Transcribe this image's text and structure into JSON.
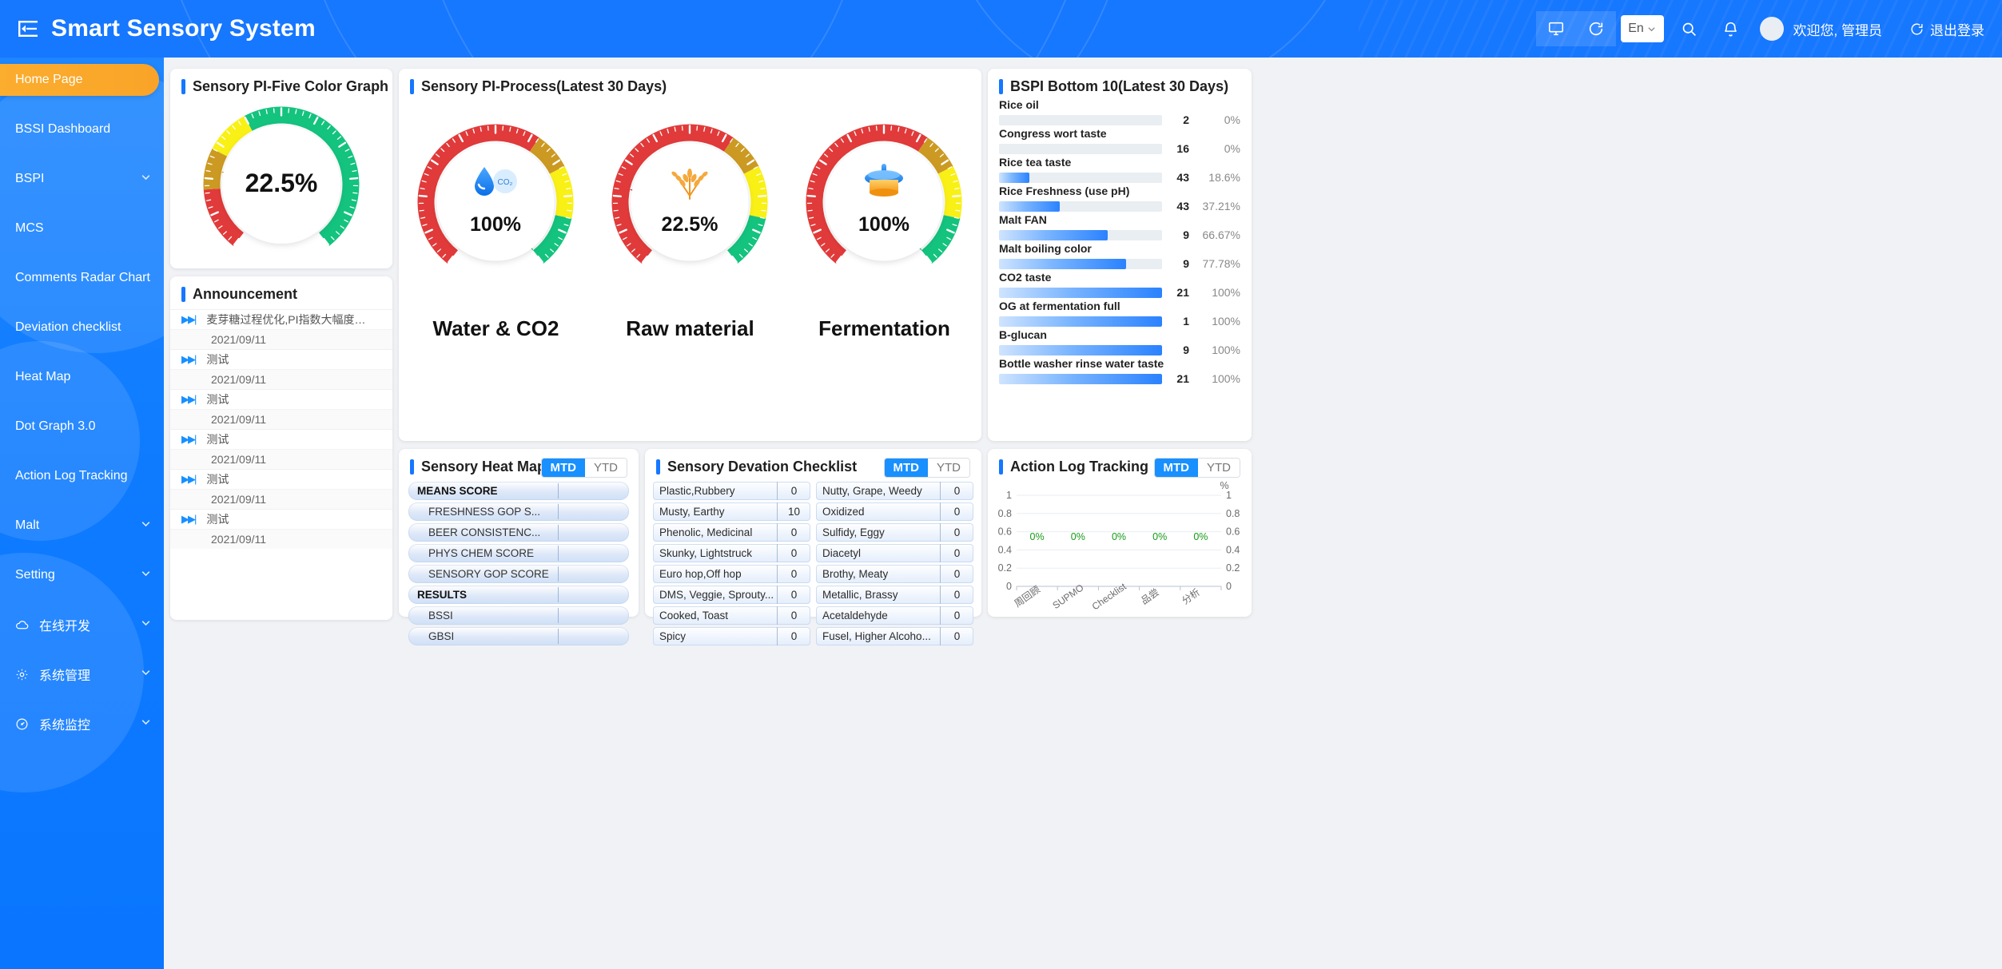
{
  "header": {
    "title": "Smart Sensory System",
    "menu_icon": "hamburger-collapse-icon",
    "monitor_icon": "monitor-icon",
    "refresh_icon": "refresh-icon",
    "language": "En",
    "search_icon": "search-icon",
    "bell_icon": "bell-icon",
    "welcome": "欢迎您, 管理员",
    "logout": "退出登录"
  },
  "sidebar": {
    "items": [
      {
        "label": "Home Page",
        "active": true,
        "caret": false,
        "icon": ""
      },
      {
        "label": "BSSI Dashboard",
        "active": false,
        "caret": false,
        "icon": ""
      },
      {
        "label": "BSPI",
        "active": false,
        "caret": true,
        "icon": ""
      },
      {
        "label": "MCS",
        "active": false,
        "caret": false,
        "icon": ""
      },
      {
        "label": "Comments Radar Chart",
        "active": false,
        "caret": false,
        "icon": ""
      },
      {
        "label": "Deviation checklist",
        "active": false,
        "caret": false,
        "icon": ""
      },
      {
        "label": "Heat Map",
        "active": false,
        "caret": false,
        "icon": ""
      },
      {
        "label": "Dot Graph 3.0",
        "active": false,
        "caret": false,
        "icon": ""
      },
      {
        "label": "Action Log Tracking",
        "active": false,
        "caret": false,
        "icon": ""
      },
      {
        "label": "Malt",
        "active": false,
        "caret": true,
        "icon": ""
      },
      {
        "label": "Setting",
        "active": false,
        "caret": true,
        "icon": ""
      },
      {
        "label": "在线开发",
        "active": false,
        "caret": true,
        "icon": "cloud-icon"
      },
      {
        "label": "系统管理",
        "active": false,
        "caret": true,
        "icon": "gear-icon"
      },
      {
        "label": "系统监控",
        "active": false,
        "caret": true,
        "icon": "dashboard-icon"
      }
    ]
  },
  "five_color": {
    "title": "Sensory PI-Five Color Graph",
    "value": "22.5%",
    "value_num": 22.5
  },
  "process": {
    "title": "Sensory PI-Process(Latest 30 Days)",
    "gauges": [
      {
        "caption": "Water & CO2",
        "value": "100%",
        "value_num": 100,
        "icon": "water-co2-icon"
      },
      {
        "caption": "Raw material",
        "value": "22.5%",
        "value_num": 22.5,
        "icon": "wheat-icon"
      },
      {
        "caption": "Fermentation",
        "value": "100%",
        "value_num": 100,
        "icon": "fermenter-icon"
      }
    ]
  },
  "announcement": {
    "title": "Announcement",
    "items": [
      {
        "text": "麦芽糖过程优化,PI指数大幅度提升,信息...",
        "date": "2021/09/11"
      },
      {
        "text": "测试",
        "date": "2021/09/11"
      },
      {
        "text": "测试",
        "date": "2021/09/11"
      },
      {
        "text": "测试",
        "date": "2021/09/11"
      },
      {
        "text": "测试",
        "date": "2021/09/11"
      },
      {
        "text": "测试",
        "date": "2021/09/11"
      }
    ]
  },
  "bspi_bottom": {
    "title": "BSPI Bottom 10(Latest 30 Days)",
    "rows": [
      {
        "name": "Rice oil",
        "count": "2",
        "pct": "0%",
        "pct_num": 0
      },
      {
        "name": "Congress wort taste",
        "count": "16",
        "pct": "0%",
        "pct_num": 0
      },
      {
        "name": "Rice tea taste",
        "count": "43",
        "pct": "18.6%",
        "pct_num": 18.6
      },
      {
        "name": "Rice Freshness (use pH)",
        "count": "43",
        "pct": "37.21%",
        "pct_num": 37.21
      },
      {
        "name": "Malt FAN",
        "count": "9",
        "pct": "66.67%",
        "pct_num": 66.67
      },
      {
        "name": "Malt boiling color",
        "count": "9",
        "pct": "77.78%",
        "pct_num": 77.78
      },
      {
        "name": "CO2 taste",
        "count": "21",
        "pct": "100%",
        "pct_num": 100
      },
      {
        "name": "OG at fermentation full",
        "count": "1",
        "pct": "100%",
        "pct_num": 100
      },
      {
        "name": "B-glucan",
        "count": "9",
        "pct": "100%",
        "pct_num": 100
      },
      {
        "name": "Bottle washer rinse water taste",
        "count": "21",
        "pct": "100%",
        "pct_num": 100
      }
    ]
  },
  "heatmap": {
    "title": "Sensory Heat Map",
    "tabs": [
      "MTD",
      "YTD"
    ],
    "selected_tab": "MTD",
    "rows": [
      {
        "label": "MEANS SCORE",
        "group": true,
        "value": ""
      },
      {
        "label": "FRESHNESS GOP S...",
        "group": false,
        "value": ""
      },
      {
        "label": "BEER CONSISTENC...",
        "group": false,
        "value": ""
      },
      {
        "label": "PHYS CHEM SCORE",
        "group": false,
        "value": ""
      },
      {
        "label": "SENSORY GOP SCORE",
        "group": false,
        "value": ""
      },
      {
        "label": "RESULTS",
        "group": true,
        "value": ""
      },
      {
        "label": "BSSI",
        "group": false,
        "value": ""
      },
      {
        "label": "GBSI",
        "group": false,
        "value": ""
      }
    ]
  },
  "deviation": {
    "title": "Sensory Devation Checklist",
    "tabs": [
      "MTD",
      "YTD"
    ],
    "selected_tab": "MTD",
    "cells": [
      {
        "label": "Plastic,Rubbery",
        "value": "0"
      },
      {
        "label": "Nutty, Grape, Weedy",
        "value": "0"
      },
      {
        "label": "Musty, Earthy",
        "value": "10"
      },
      {
        "label": "Oxidized",
        "value": "0"
      },
      {
        "label": "Phenolic, Medicinal",
        "value": "0"
      },
      {
        "label": "Sulfidy, Eggy",
        "value": "0"
      },
      {
        "label": "Skunky, Lightstruck",
        "value": "0"
      },
      {
        "label": "Diacetyl",
        "value": "0"
      },
      {
        "label": "Euro hop,Off hop",
        "value": "0"
      },
      {
        "label": "Brothy, Meaty",
        "value": "0"
      },
      {
        "label": "DMS, Veggie, Sprouty...",
        "value": "0"
      },
      {
        "label": "Metallic, Brassy",
        "value": "0"
      },
      {
        "label": "Cooked, Toast",
        "value": "0"
      },
      {
        "label": "Acetaldehyde",
        "value": "0"
      },
      {
        "label": "Spicy",
        "value": "0"
      },
      {
        "label": "Fusel, Higher Alcoho...",
        "value": "0"
      }
    ]
  },
  "action_log": {
    "title": "Action Log Tracking",
    "tabs": [
      "MTD",
      "YTD"
    ],
    "selected_tab": "MTD",
    "unit": "%"
  },
  "chart_data": {
    "type": "bar",
    "title": "Action Log Tracking",
    "categories": [
      "周回顾",
      "SUPMO",
      "Checklist",
      "品尝",
      "分析"
    ],
    "values": [
      0,
      0,
      0,
      0,
      0
    ],
    "data_labels": [
      "0%",
      "0%",
      "0%",
      "0%",
      "0%"
    ],
    "yticks": [
      "0",
      "0.2",
      "0.4",
      "0.6",
      "0.8",
      "1"
    ],
    "y2ticks": [
      "0",
      "0.2",
      "0.4",
      "0.6",
      "0.8",
      "1"
    ],
    "ylim": [
      0,
      1
    ],
    "ylabel": "",
    "y2label": "%",
    "xlabel": "",
    "grid": true,
    "legend": "none",
    "label_color": "#169b16"
  }
}
